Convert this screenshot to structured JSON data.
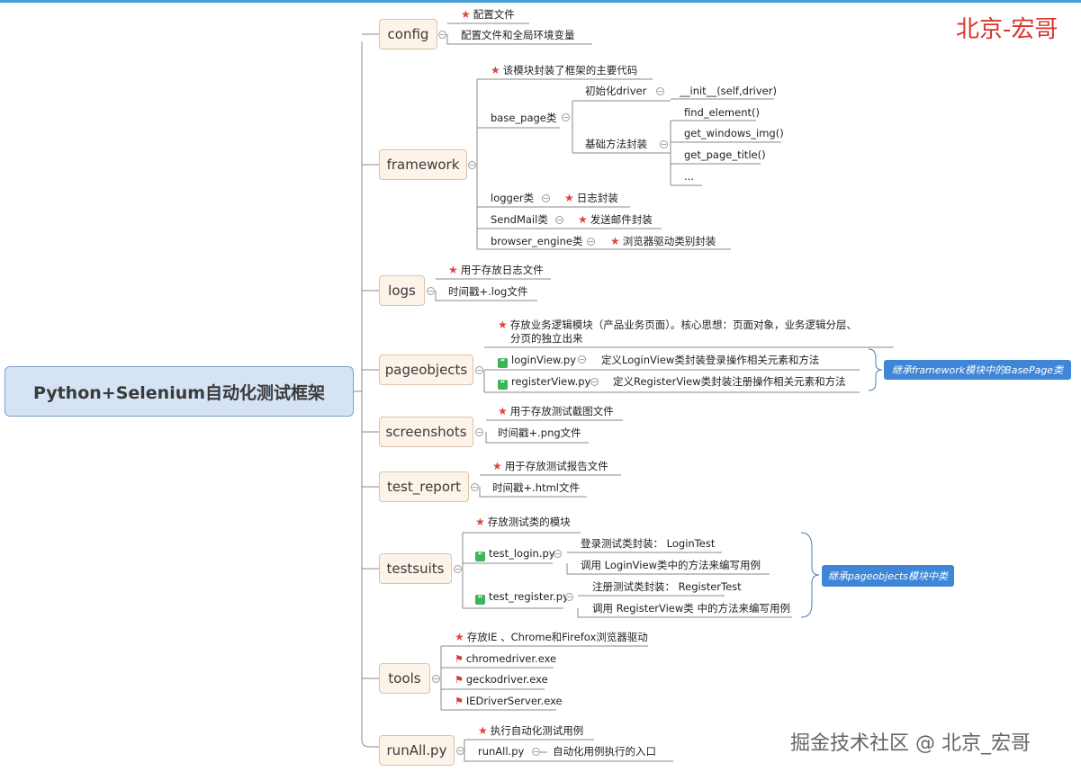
{
  "root": "Python+Selenium自动化测试框架",
  "watermark_top": "北京-宏哥",
  "watermark_bottom": "掘金技术社区 @ 北京_宏哥",
  "config": {
    "label": "config",
    "items": [
      "配置文件",
      "配置文件和全局环境变量"
    ]
  },
  "framework": {
    "label": "framework",
    "note": "该模块封装了框架的主要代码",
    "base_page": "base_page类",
    "init": "初始化driver",
    "init_method": "__init__(self,driver)",
    "basic": "基础方法封装",
    "methods": [
      "find_element()",
      "get_windows_img()",
      "get_page_title()",
      "..."
    ],
    "logger": "logger类",
    "logger_note": "日志封装",
    "sendmail": "SendMail类",
    "sendmail_note": "发送邮件封装",
    "engine": "browser_engine类",
    "engine_note": "浏览器驱动类别封装"
  },
  "logs": {
    "label": "logs",
    "items": [
      "用于存放日志文件",
      "时间戳+.log文件"
    ]
  },
  "pageobjects": {
    "label": "pageobjects",
    "note_line1": "存放业务逻辑模块（产品业务页面）。核心思想：页面对象，业务逻辑分层、",
    "note_line2": "分页的独立出来",
    "login_file": "loginView.py",
    "login_desc": "定义LoginView类封装登录操作相关元素和方法",
    "register_file": "registerView.py",
    "register_desc": "定义RegisterView类封装注册操作相关元素和方法",
    "callout": "继承framework模块中的BasePage类"
  },
  "screenshots": {
    "label": "screenshots",
    "items": [
      "用于存放测试截图文件",
      "时间戳+.png文件"
    ]
  },
  "test_report": {
    "label": "test_report",
    "items": [
      "用于存放测试报告文件",
      "时间戳+.html文件"
    ]
  },
  "testsuits": {
    "label": "testsuits",
    "note": "存放测试类的模块",
    "login_file": "test_login.py",
    "login_a": "登录测试类封装：   LoginTest",
    "login_b": "调用 LoginView类中的方法来编写用例",
    "register_file": "test_register.py",
    "register_a": "注册测试类封装：   RegisterTest",
    "register_b": "调用 RegisterView类 中的方法来编写用例",
    "callout": "继承pageobjects模块中类"
  },
  "tools": {
    "label": "tools",
    "note": "存放IE 、Chrome和Firefox浏览器驱动",
    "items": [
      "chromedriver.exe",
      "geckodriver.exe",
      "IEDriverServer.exe"
    ]
  },
  "runall": {
    "label": "runAll.py",
    "note": "执行自动化测试用例",
    "file": "runAll.py",
    "desc": "自动化用例执行的入口"
  }
}
